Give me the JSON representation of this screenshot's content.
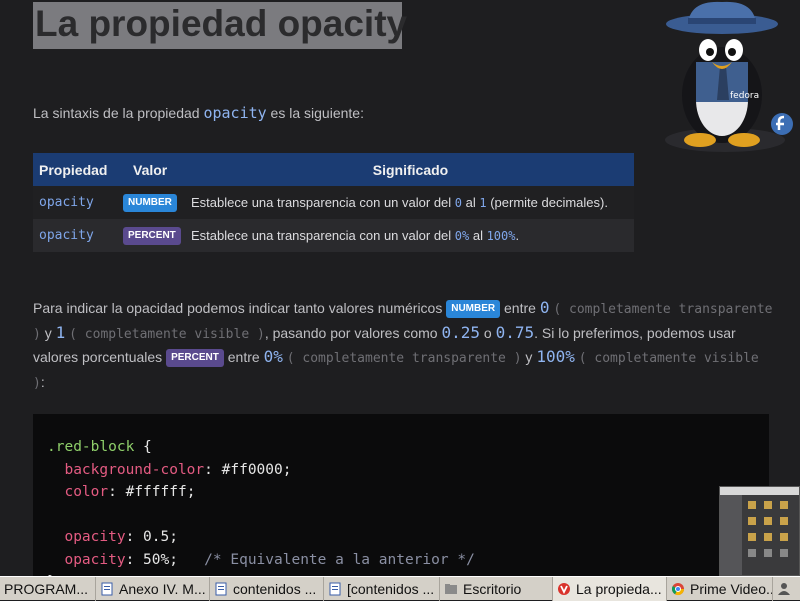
{
  "title": "La propiedad opacity",
  "intro": {
    "before": "La sintaxis de la propiedad ",
    "code": "opacity",
    "after": " es la siguiente:"
  },
  "mascot": {
    "hat_label": "fedora"
  },
  "table": {
    "headers": [
      "Propiedad",
      "Valor",
      "Significado"
    ],
    "rows": [
      {
        "prop": "opacity",
        "badge": "NUMBER",
        "text_a": "Establece una transparencia con un valor del ",
        "v1": "0",
        "text_b": " al ",
        "v2": "1",
        "text_c": " (permite decimales)."
      },
      {
        "prop": "opacity",
        "badge": "PERCENT",
        "text_a": "Establece una transparencia con un valor del ",
        "v1": "0%",
        "text_b": " al ",
        "v2": "100%",
        "text_c": "."
      }
    ]
  },
  "paragraph": {
    "p1": "Para indicar la opacidad podemos indicar tanto valores numéricos ",
    "badge_number": "NUMBER",
    "p2": " entre ",
    "n0": "0",
    "paren1": "( completamente transparente )",
    "p3": " y ",
    "n1": "1",
    "paren2": "( completamente visible )",
    "p4": ", pasando por valores como ",
    "n025": "0.25",
    "p5": " o ",
    "n075": "0.75",
    "p6": ". Si lo preferimos, podemos usar valores porcentuales ",
    "badge_percent": "PERCENT",
    "p7": " entre ",
    "n0p": "0%",
    "paren3": "( completamente transparente )",
    "p8": " y ",
    "n100p": "100%",
    "paren4": "( completamente visible )",
    "p9": ":"
  },
  "code": {
    "selector": ".red-block",
    "open": " {",
    "lines": [
      {
        "prop": "background-color",
        "value": "#ff0000;"
      },
      {
        "prop": "color",
        "value": "#ffffff;"
      },
      {
        "prop": "opacity",
        "value": "0.5;"
      },
      {
        "prop": "opacity",
        "value": "50%;",
        "comment": "/* Equivalente a la anterior */"
      }
    ],
    "close": "}"
  },
  "taskbar": {
    "items": [
      {
        "label": "PROGRAM...",
        "icon": "folder-icon"
      },
      {
        "label": "Anexo IV. M...",
        "icon": "document-icon"
      },
      {
        "label": "contenidos ...",
        "icon": "document-icon"
      },
      {
        "label": "[contenidos ...",
        "icon": "document-icon"
      },
      {
        "label": "Escritorio",
        "icon": "folder-icon"
      },
      {
        "label": "La propieda...",
        "icon": "vivaldi-icon"
      },
      {
        "label": "Prime Video...",
        "icon": "chrome-icon"
      },
      {
        "label": "",
        "icon": "user-icon"
      }
    ]
  },
  "colors": {
    "accent": "#1b3c73",
    "number_badge": "#2a86d8",
    "percent_badge": "#5a4a8e",
    "code_prop": "#e45b82",
    "code_selector": "#8fcf6a"
  }
}
